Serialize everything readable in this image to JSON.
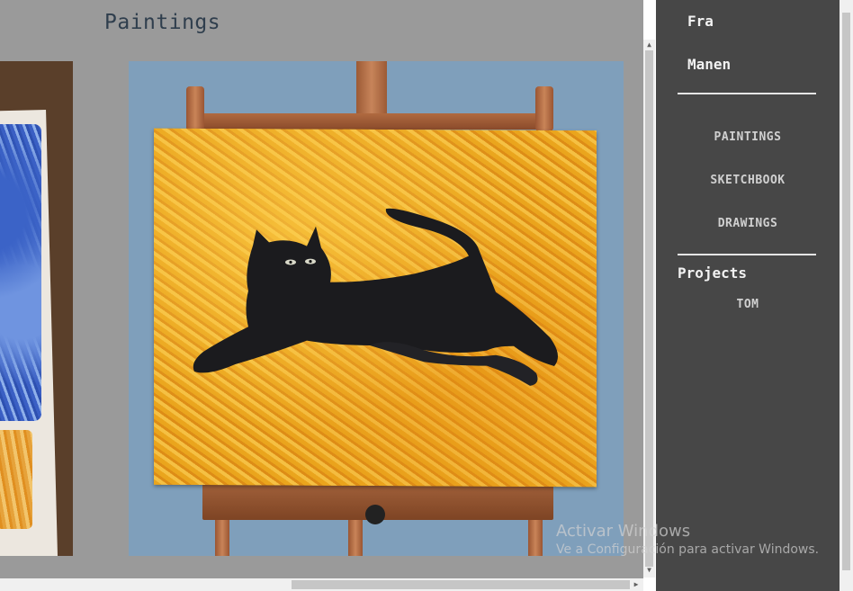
{
  "page": {
    "title": "Paintings"
  },
  "gallery": {
    "items": [
      {
        "alt": "Blue and orange oil pastel painting on paper"
      },
      {
        "alt": "Oil painting of a black cat leaping on a yellow background, on a wooden easel"
      }
    ]
  },
  "sidebar": {
    "brand_first": "Fra",
    "brand_last": "Manen",
    "nav": [
      {
        "label": "PAINTINGS"
      },
      {
        "label": "SKETCHBOOK"
      },
      {
        "label": "DRAWINGS"
      }
    ],
    "projects_heading": "Projects",
    "projects": [
      {
        "label": "TOM"
      }
    ]
  },
  "watermark": {
    "title": "Activar Windows",
    "subtitle": "Ve a Configuración para activar Windows."
  },
  "colors": {
    "sidebar_bg": "#474747",
    "viewport_bg": "#9a9a9a",
    "painting_bg": "#eaa51d",
    "title_color": "#2f3e4d"
  },
  "icons": {
    "scroll_up": "▲",
    "scroll_down": "▼",
    "scroll_right": "▶"
  }
}
